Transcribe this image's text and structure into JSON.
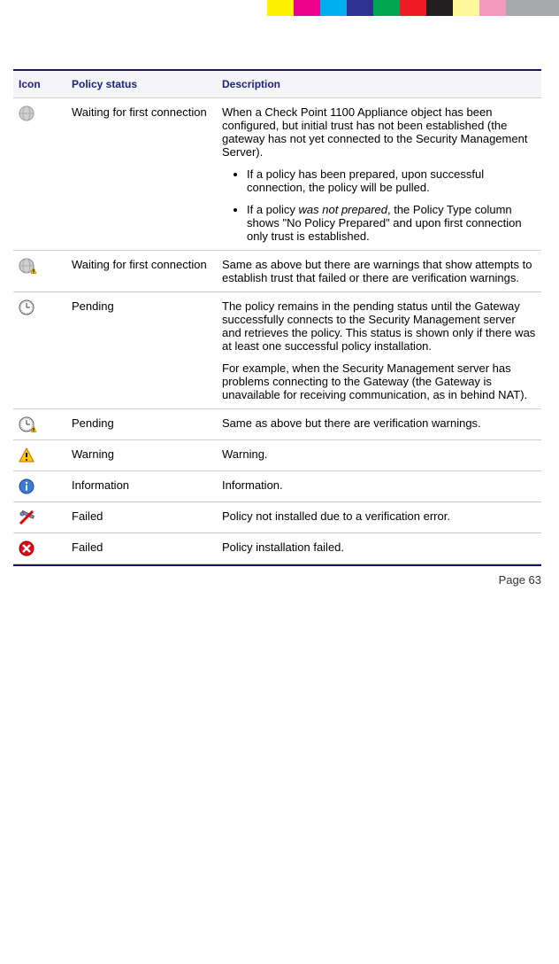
{
  "colorbar": [
    "#fff200",
    "#ec008c",
    "#00aeef",
    "#2e3192",
    "#00a651",
    "#ed1c24",
    "#231f20",
    "#fff799",
    "#f49ac1",
    "#a7a9ac",
    "#a7a9ac"
  ],
  "table": {
    "headers": {
      "icon": "Icon",
      "status": "Policy status",
      "description": "Description"
    },
    "rows": [
      {
        "icon": "globe-gray",
        "status": "Waiting for first connection",
        "desc_p1": "When a Check Point 1100 Appliance object has been configured, but initial trust has not been established (the gateway has not yet connected to the Security Management Server).",
        "bullet1_a": "If a policy has been prepared, upon successful connection, the policy will be pulled.",
        "bullet2_a": "If a policy ",
        "bullet2_em": "was not prepared",
        "bullet2_b": ", the Policy Type column shows \"No Policy Prepared\" and upon first connection only trust is established."
      },
      {
        "icon": "globe-warn",
        "status": "Waiting for first connection",
        "desc_p1": "Same as above but there are warnings that show attempts to establish trust that failed or there are verification warnings."
      },
      {
        "icon": "clock",
        "status": "Pending",
        "desc_p1": "The policy remains in the pending status until the Gateway successfully connects to the Security Management server and retrieves the policy. This status is shown only if there was at least one successful policy installation.",
        "desc_p2": "For example, when the Security Management server has problems connecting to the Gateway (the Gateway is unavailable for receiving communication, as in behind NAT)."
      },
      {
        "icon": "clock-warn",
        "status": "Pending",
        "desc_p1": "Same as above but there are verification warnings."
      },
      {
        "icon": "warning",
        "status": "Warning",
        "desc_p1": "Warning."
      },
      {
        "icon": "info",
        "status": "Information",
        "desc_p1": "Information."
      },
      {
        "icon": "tool-fail",
        "status": "Failed",
        "desc_p1": "Policy not installed due to a verification error."
      },
      {
        "icon": "cross",
        "status": "Failed",
        "desc_p1": "Policy installation failed."
      }
    ]
  },
  "footer": {
    "page_label": "Page 63"
  }
}
